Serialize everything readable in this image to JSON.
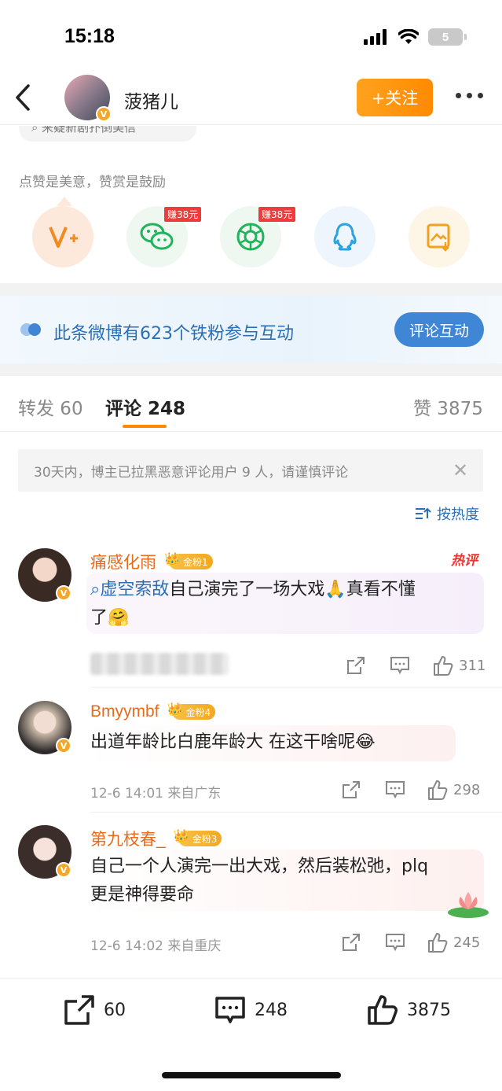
{
  "status": {
    "time": "15:18",
    "battery": "5"
  },
  "header": {
    "name": "菠猪儿",
    "follow_label": "+关注"
  },
  "partial_search": "来疑新剧扑倒美信",
  "reward_tip": "点赞是美意，赞赏是鼓励",
  "share": {
    "items": [
      {
        "icon": "v-plus-icon",
        "badge": ""
      },
      {
        "icon": "wechat-icon",
        "badge": "赚38元"
      },
      {
        "icon": "moments-icon",
        "badge": "赚38元"
      },
      {
        "icon": "qq-icon",
        "badge": ""
      },
      {
        "icon": "save-image-icon",
        "badge": ""
      }
    ]
  },
  "iron_fans": {
    "text": "此条微博有623个铁粉参与互动",
    "button": "评论互动"
  },
  "tabs": {
    "repost": "转发 60",
    "comment": "评论 248",
    "like": "赞 3875"
  },
  "notice": "30天内，博主已拉黑恶意评论用户 9 人，请谨慎评论",
  "sort_label": "按热度",
  "hot_label": "热评",
  "comments": [
    {
      "name": "痛感化雨",
      "badge": "金粉1",
      "topic": "虚空索敌",
      "text_line1": "自己演完了一场大戏🙏真看不懂",
      "text_line2": "了🤗",
      "meta": "",
      "likes": "311"
    },
    {
      "name": "Bmyymbf",
      "badge": "金粉4",
      "text_line1": "出道年龄比白鹿年龄大 在这干啥呢😂",
      "meta": "12-6 14:01 来自广东",
      "likes": "298"
    },
    {
      "name": "第九枝春_",
      "badge": "金粉3",
      "text_line1": "自己一个人演完一出大戏，然后装松弛，plq",
      "text_line2": "更是神得要命",
      "meta": "12-6 14:02 来自重庆",
      "likes": "245"
    }
  ],
  "bottom": {
    "repost": "60",
    "comment": "248",
    "like": "3875"
  },
  "colors": {
    "accent": "#ff8a00",
    "link": "#2a6fb6",
    "name": "#e86b1c"
  }
}
